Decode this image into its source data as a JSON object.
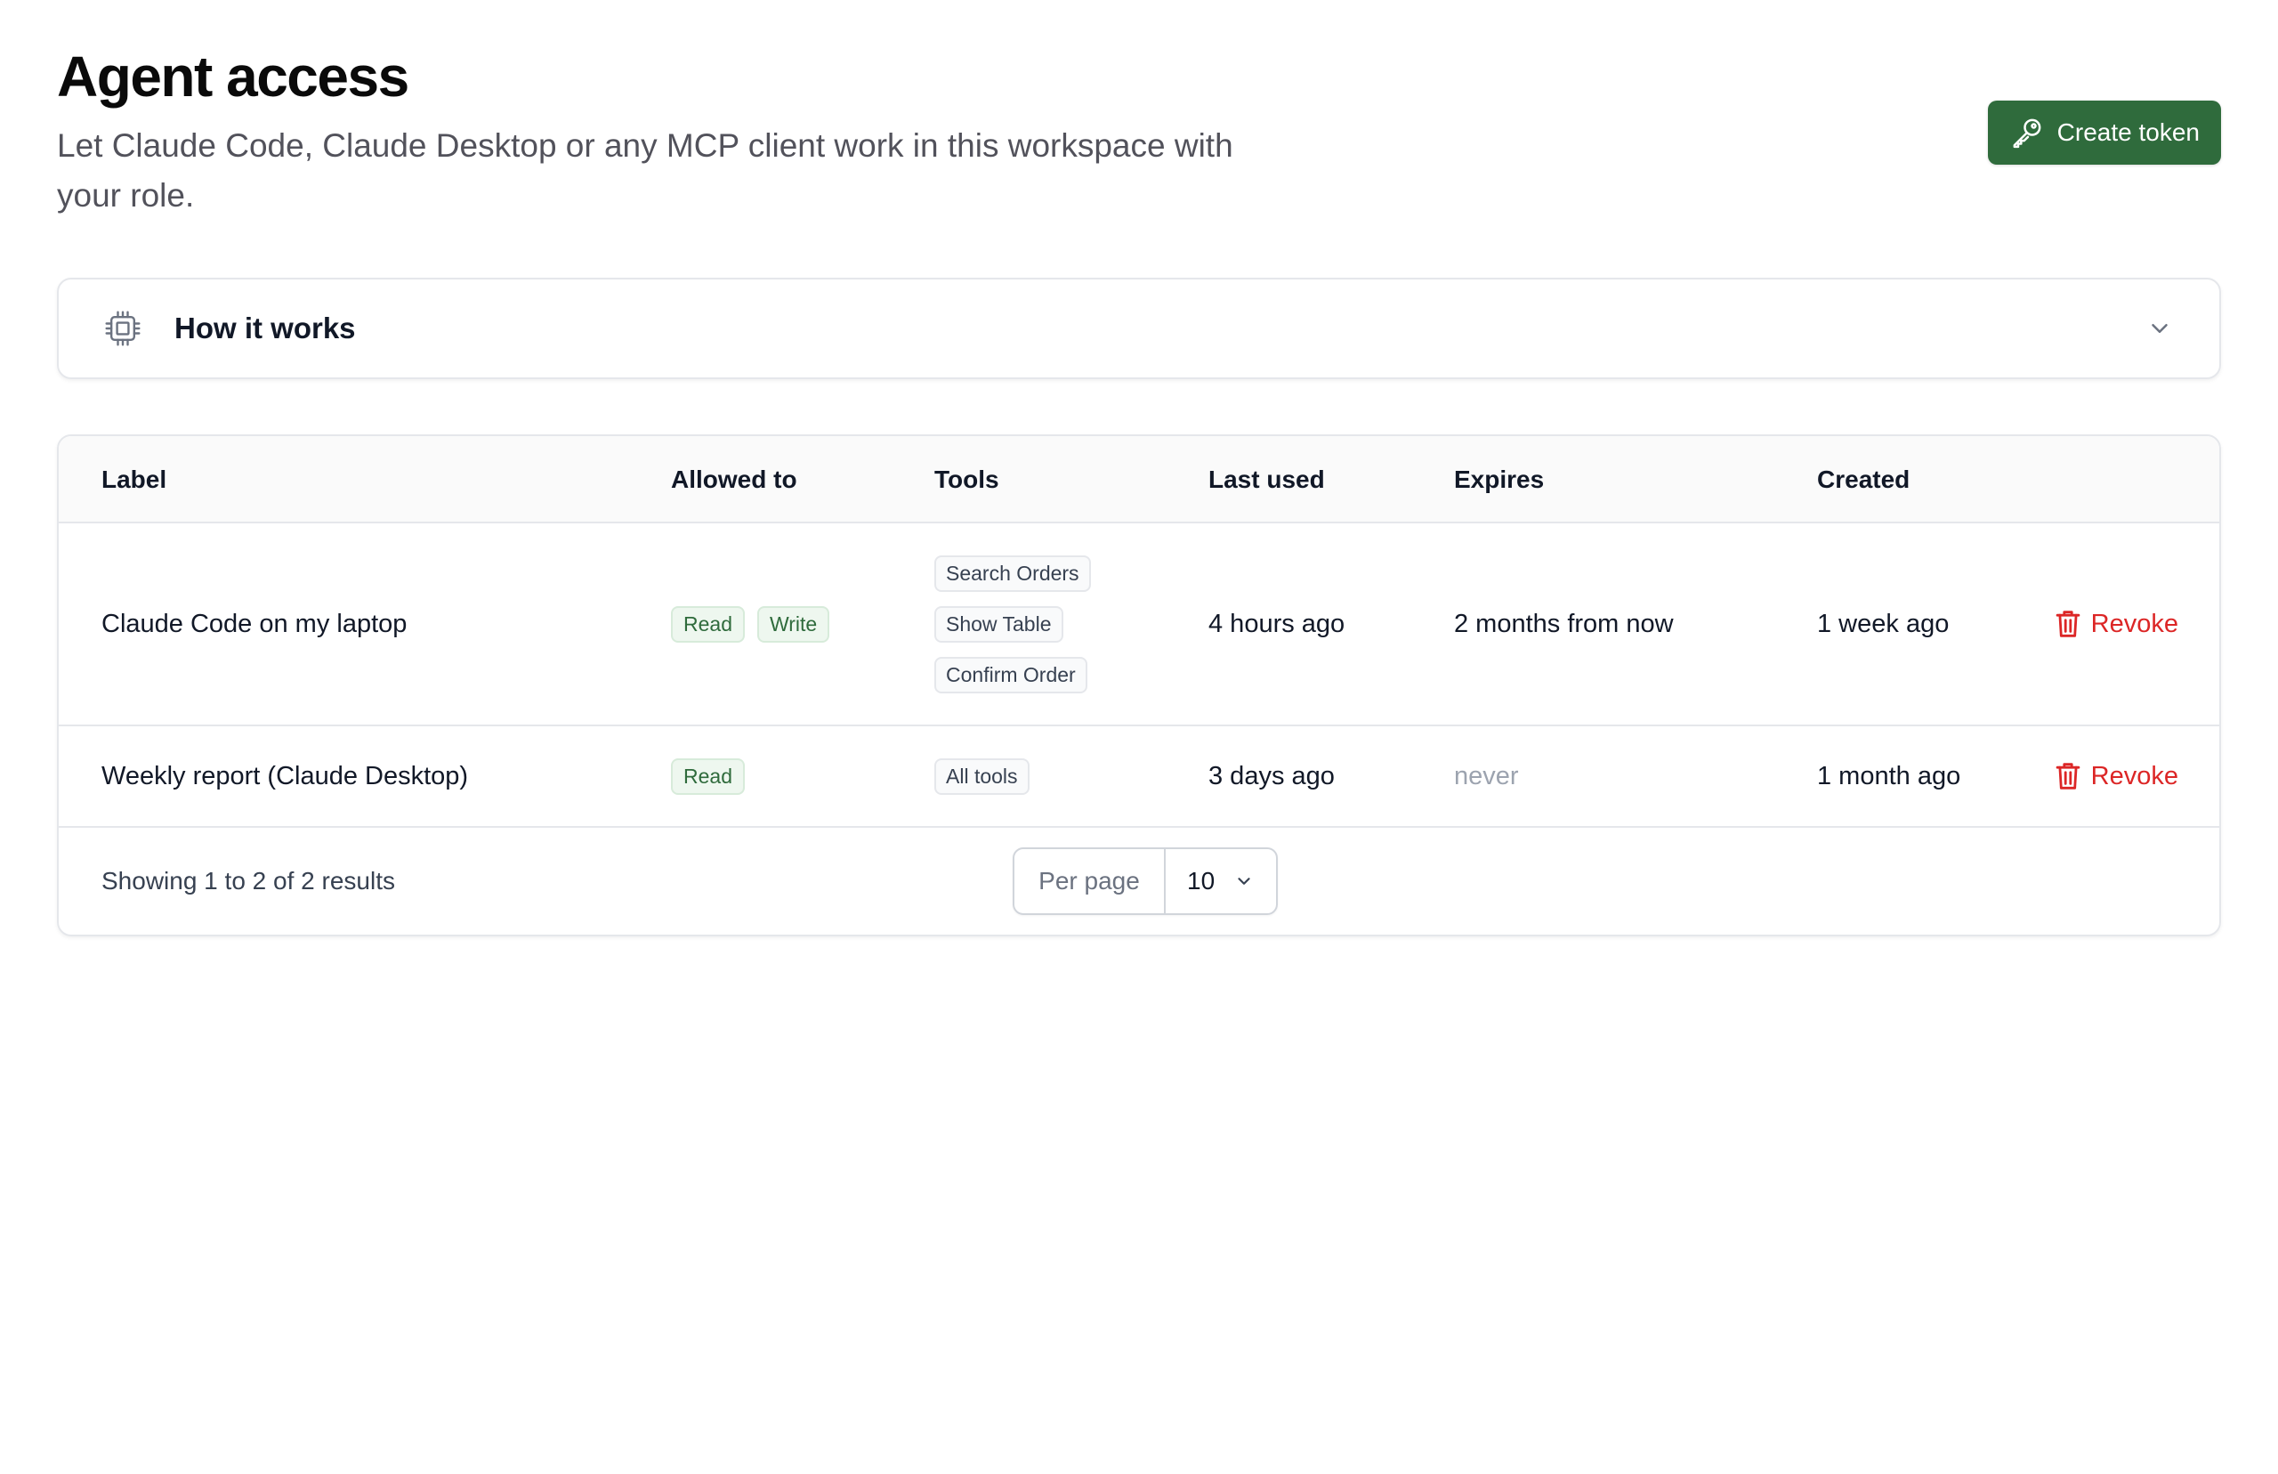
{
  "header": {
    "title": "Agent access",
    "subtitle": "Let Claude Code, Claude Desktop or any MCP client work in this workspace with your role.",
    "create_button": {
      "label": "Create token",
      "icon": "key-icon"
    }
  },
  "how_it_works": {
    "title": "How it works",
    "icon": "chip-icon",
    "expand_icon": "chevron-down-icon"
  },
  "table": {
    "columns": {
      "label": "Label",
      "allowed": "Allowed to",
      "tools": "Tools",
      "last_used": "Last used",
      "expires": "Expires",
      "created": "Created"
    },
    "rows": [
      {
        "label": "Claude Code on my laptop",
        "allowed": [
          "Read",
          "Write"
        ],
        "tools": [
          "Search Orders",
          "Show Table",
          "Confirm Order"
        ],
        "last_used": "4 hours ago",
        "expires": "2 months from now",
        "created": "1 week ago",
        "action": "Revoke"
      },
      {
        "label": "Weekly report (Claude Desktop)",
        "allowed": [
          "Read"
        ],
        "tools": [
          "All tools"
        ],
        "last_used": "3 days ago",
        "expires": "never",
        "created": "1 month ago",
        "action": "Revoke"
      }
    ]
  },
  "footer": {
    "showing": "Showing 1 to 2 of 2 results",
    "per_page_label": "Per page",
    "per_page_value": "10"
  },
  "colors": {
    "accent": "#2f6b3c",
    "danger": "#dc2626",
    "border": "#e5e7eb"
  }
}
